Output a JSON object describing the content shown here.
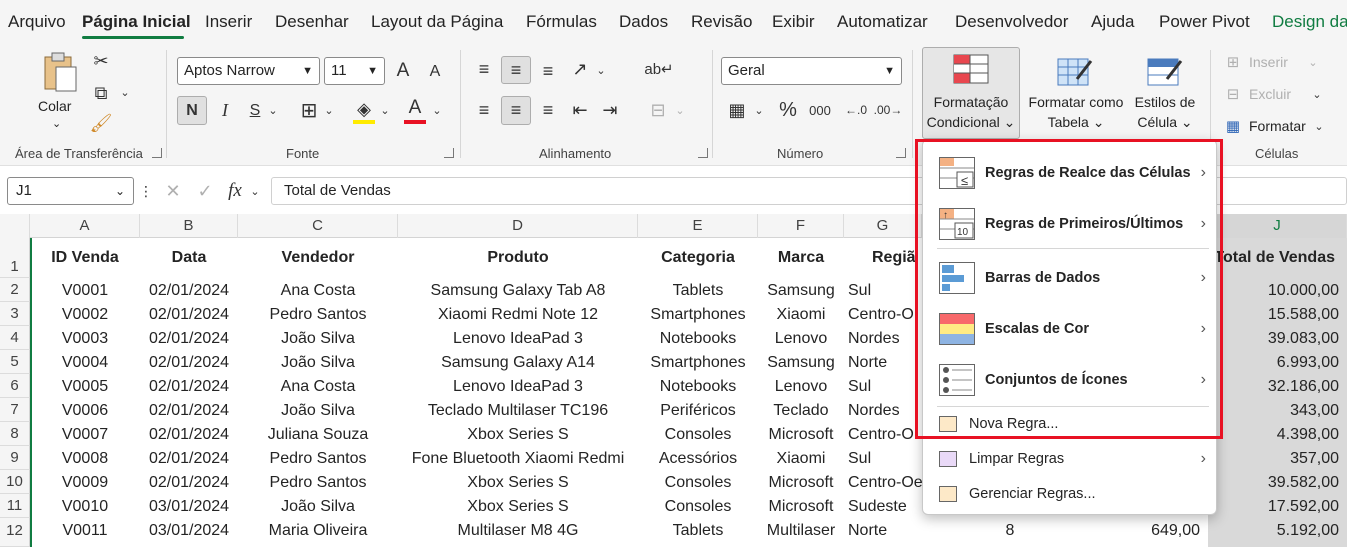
{
  "menu_tabs": [
    "Arquivo",
    "Página Inicial",
    "Inserir",
    "Desenhar",
    "Layout da Página",
    "Fórmulas",
    "Dados",
    "Revisão",
    "Exibir",
    "Automatizar",
    "Desenvolvedor",
    "Ajuda",
    "Power Pivot",
    "Design da"
  ],
  "ribbon": {
    "clipboard": {
      "paste_label": "Colar",
      "group_label": "Área de Transferência"
    },
    "font": {
      "name": "Aptos Narrow",
      "size": "11",
      "bold": "N",
      "italic": "I",
      "underline": "S",
      "grow": "A",
      "shrink": "A",
      "color_a": "A",
      "group_label": "Fonte"
    },
    "alignment": {
      "group_label": "Alinhamento"
    },
    "number": {
      "format": "Geral",
      "percent": "%",
      "thousands": "000",
      "group_label": "Número"
    },
    "styles": {
      "cond_format": [
        "Formatação",
        "Condicional ⌄"
      ],
      "format_table": [
        "Formatar como",
        "Tabela ⌄"
      ],
      "cell_styles": [
        "Estilos de",
        "Célula ⌄"
      ]
    },
    "cells": {
      "insert": "Inserir",
      "delete": "Excluir",
      "format": "Formatar",
      "group_label": "Células"
    }
  },
  "formula_bar": {
    "name_box": "J1",
    "fx": "fx",
    "content": "Total de Vendas"
  },
  "columns": [
    "A",
    "B",
    "C",
    "D",
    "E",
    "F",
    "G",
    "J"
  ],
  "rows": [
    "1",
    "2",
    "3",
    "4",
    "5",
    "6",
    "7",
    "8",
    "9",
    "10",
    "11",
    "12"
  ],
  "headers": {
    "A": "ID Venda",
    "B": "Data",
    "C": "Vendedor",
    "D": "Produto",
    "E": "Categoria",
    "F": "Marca",
    "G": "Regiã",
    "J": "Total de Vendas"
  },
  "data_rows": [
    [
      "V0001",
      "02/01/2024",
      "Ana Costa",
      "Samsung Galaxy Tab A8",
      "Tablets",
      "Samsung",
      "Sul",
      "10.000,00"
    ],
    [
      "V0002",
      "02/01/2024",
      "Pedro Santos",
      "Xiaomi Redmi Note 12",
      "Smartphones",
      "Xiaomi",
      "Centro-O",
      "15.588,00"
    ],
    [
      "V0003",
      "02/01/2024",
      "João Silva",
      "Lenovo IdeaPad 3",
      "Notebooks",
      "Lenovo",
      "Nordes",
      "39.083,00"
    ],
    [
      "V0004",
      "02/01/2024",
      "João Silva",
      "Samsung Galaxy A14",
      "Smartphones",
      "Samsung",
      "Norte",
      "6.993,00"
    ],
    [
      "V0005",
      "02/01/2024",
      "Ana Costa",
      "Lenovo IdeaPad 3",
      "Notebooks",
      "Lenovo",
      "Sul",
      "32.186,00"
    ],
    [
      "V0006",
      "02/01/2024",
      "João Silva",
      "Teclado Multilaser TC196",
      "Periféricos",
      "Teclado",
      "Nordes",
      "343,00"
    ],
    [
      "V0007",
      "02/01/2024",
      "Juliana Souza",
      "Xbox Series S",
      "Consoles",
      "Microsoft",
      "Centro-O",
      "4.398,00"
    ],
    [
      "V0008",
      "02/01/2024",
      "Pedro Santos",
      "Fone Bluetooth Xiaomi Redmi",
      "Acessórios",
      "Xiaomi",
      "Sul",
      "357,00"
    ],
    [
      "V0009",
      "02/01/2024",
      "Pedro Santos",
      "Xbox Series S",
      "Consoles",
      "Microsoft",
      "Centro-Oe",
      "39.582,00"
    ],
    [
      "V0010",
      "03/01/2024",
      "João Silva",
      "Xbox Series S",
      "Consoles",
      "Microsoft",
      "Sudeste",
      "17.592,00"
    ],
    [
      "V0011",
      "03/01/2024",
      "Maria Oliveira",
      "Multilaser M8 4G",
      "Tablets",
      "Multilaser",
      "Norte",
      "5.192,00"
    ]
  ],
  "row12_extra": {
    "qty": "8",
    "unit_price": "649,00"
  },
  "dropdown": {
    "main_items": [
      "Regras de Realce das Células",
      "Regras de Primeiros/Últimos",
      "Barras de Dados",
      "Escalas de Cor",
      "Conjuntos de Ícones"
    ],
    "small_items": [
      "Nova Regra...",
      "Limpar Regras",
      "Gerenciar Regras..."
    ]
  }
}
